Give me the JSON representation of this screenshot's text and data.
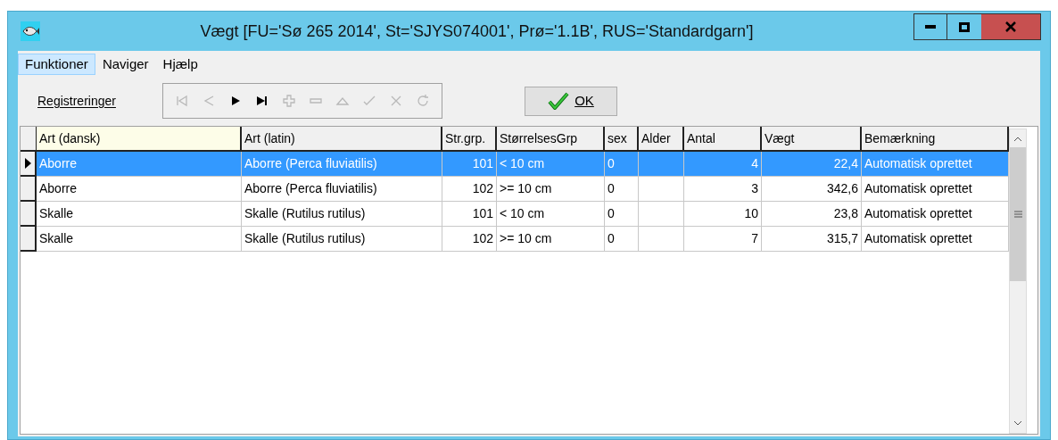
{
  "window": {
    "title": "Vægt  [FU='Sø 265 2014', St='SJYS074001', Prø='1.1B', RUS='Standardgarn']"
  },
  "menu": [
    {
      "label": "Funktioner",
      "selected": true
    },
    {
      "label": "Naviger",
      "selected": false
    },
    {
      "label": "Hjælp",
      "selected": false
    }
  ],
  "navigator": {
    "label": "Registreringer",
    "buttons": [
      {
        "kind": "first",
        "enabled": false
      },
      {
        "kind": "prior",
        "enabled": false
      },
      {
        "kind": "next",
        "enabled": true
      },
      {
        "kind": "last",
        "enabled": true
      },
      {
        "kind": "insert",
        "enabled": false
      },
      {
        "kind": "delete",
        "enabled": false
      },
      {
        "kind": "edit",
        "enabled": false
      },
      {
        "kind": "post",
        "enabled": false
      },
      {
        "kind": "cancel",
        "enabled": false
      },
      {
        "kind": "refresh",
        "enabled": false
      }
    ]
  },
  "ok_button": {
    "label": "OK"
  },
  "table": {
    "columns": [
      {
        "label": "Art (dansk)",
        "numeric": false
      },
      {
        "label": "Art (latin)",
        "numeric": false
      },
      {
        "label": "Str.grp.",
        "numeric": true
      },
      {
        "label": "StørrelsesGrp",
        "numeric": false
      },
      {
        "label": "sex",
        "numeric": false
      },
      {
        "label": "Alder"
      },
      {
        "label": "Antal",
        "numeric": true
      },
      {
        "label": "Vægt",
        "numeric": true
      },
      {
        "label": "Bemærkning",
        "numeric": false
      }
    ],
    "rows": [
      {
        "selected": true,
        "cells": [
          "Aborre",
          "Aborre (Perca fluviatilis)",
          "101",
          "< 10 cm",
          "0",
          "",
          "4",
          "22,4",
          "Automatisk oprettet"
        ]
      },
      {
        "selected": false,
        "cells": [
          "Aborre",
          "Aborre (Perca fluviatilis)",
          "102",
          ">= 10 cm",
          "0",
          "",
          "3",
          "342,6",
          "Automatisk oprettet"
        ]
      },
      {
        "selected": false,
        "cells": [
          "Skalle",
          "Skalle (Rutilus rutilus)",
          "101",
          "< 10 cm",
          "0",
          "",
          "10",
          "23,8",
          "Automatisk oprettet"
        ]
      },
      {
        "selected": false,
        "cells": [
          "Skalle",
          "Skalle (Rutilus rutilus)",
          "102",
          ">= 10 cm",
          "0",
          "",
          "7",
          "315,7",
          "Automatisk oprettet"
        ]
      }
    ]
  }
}
